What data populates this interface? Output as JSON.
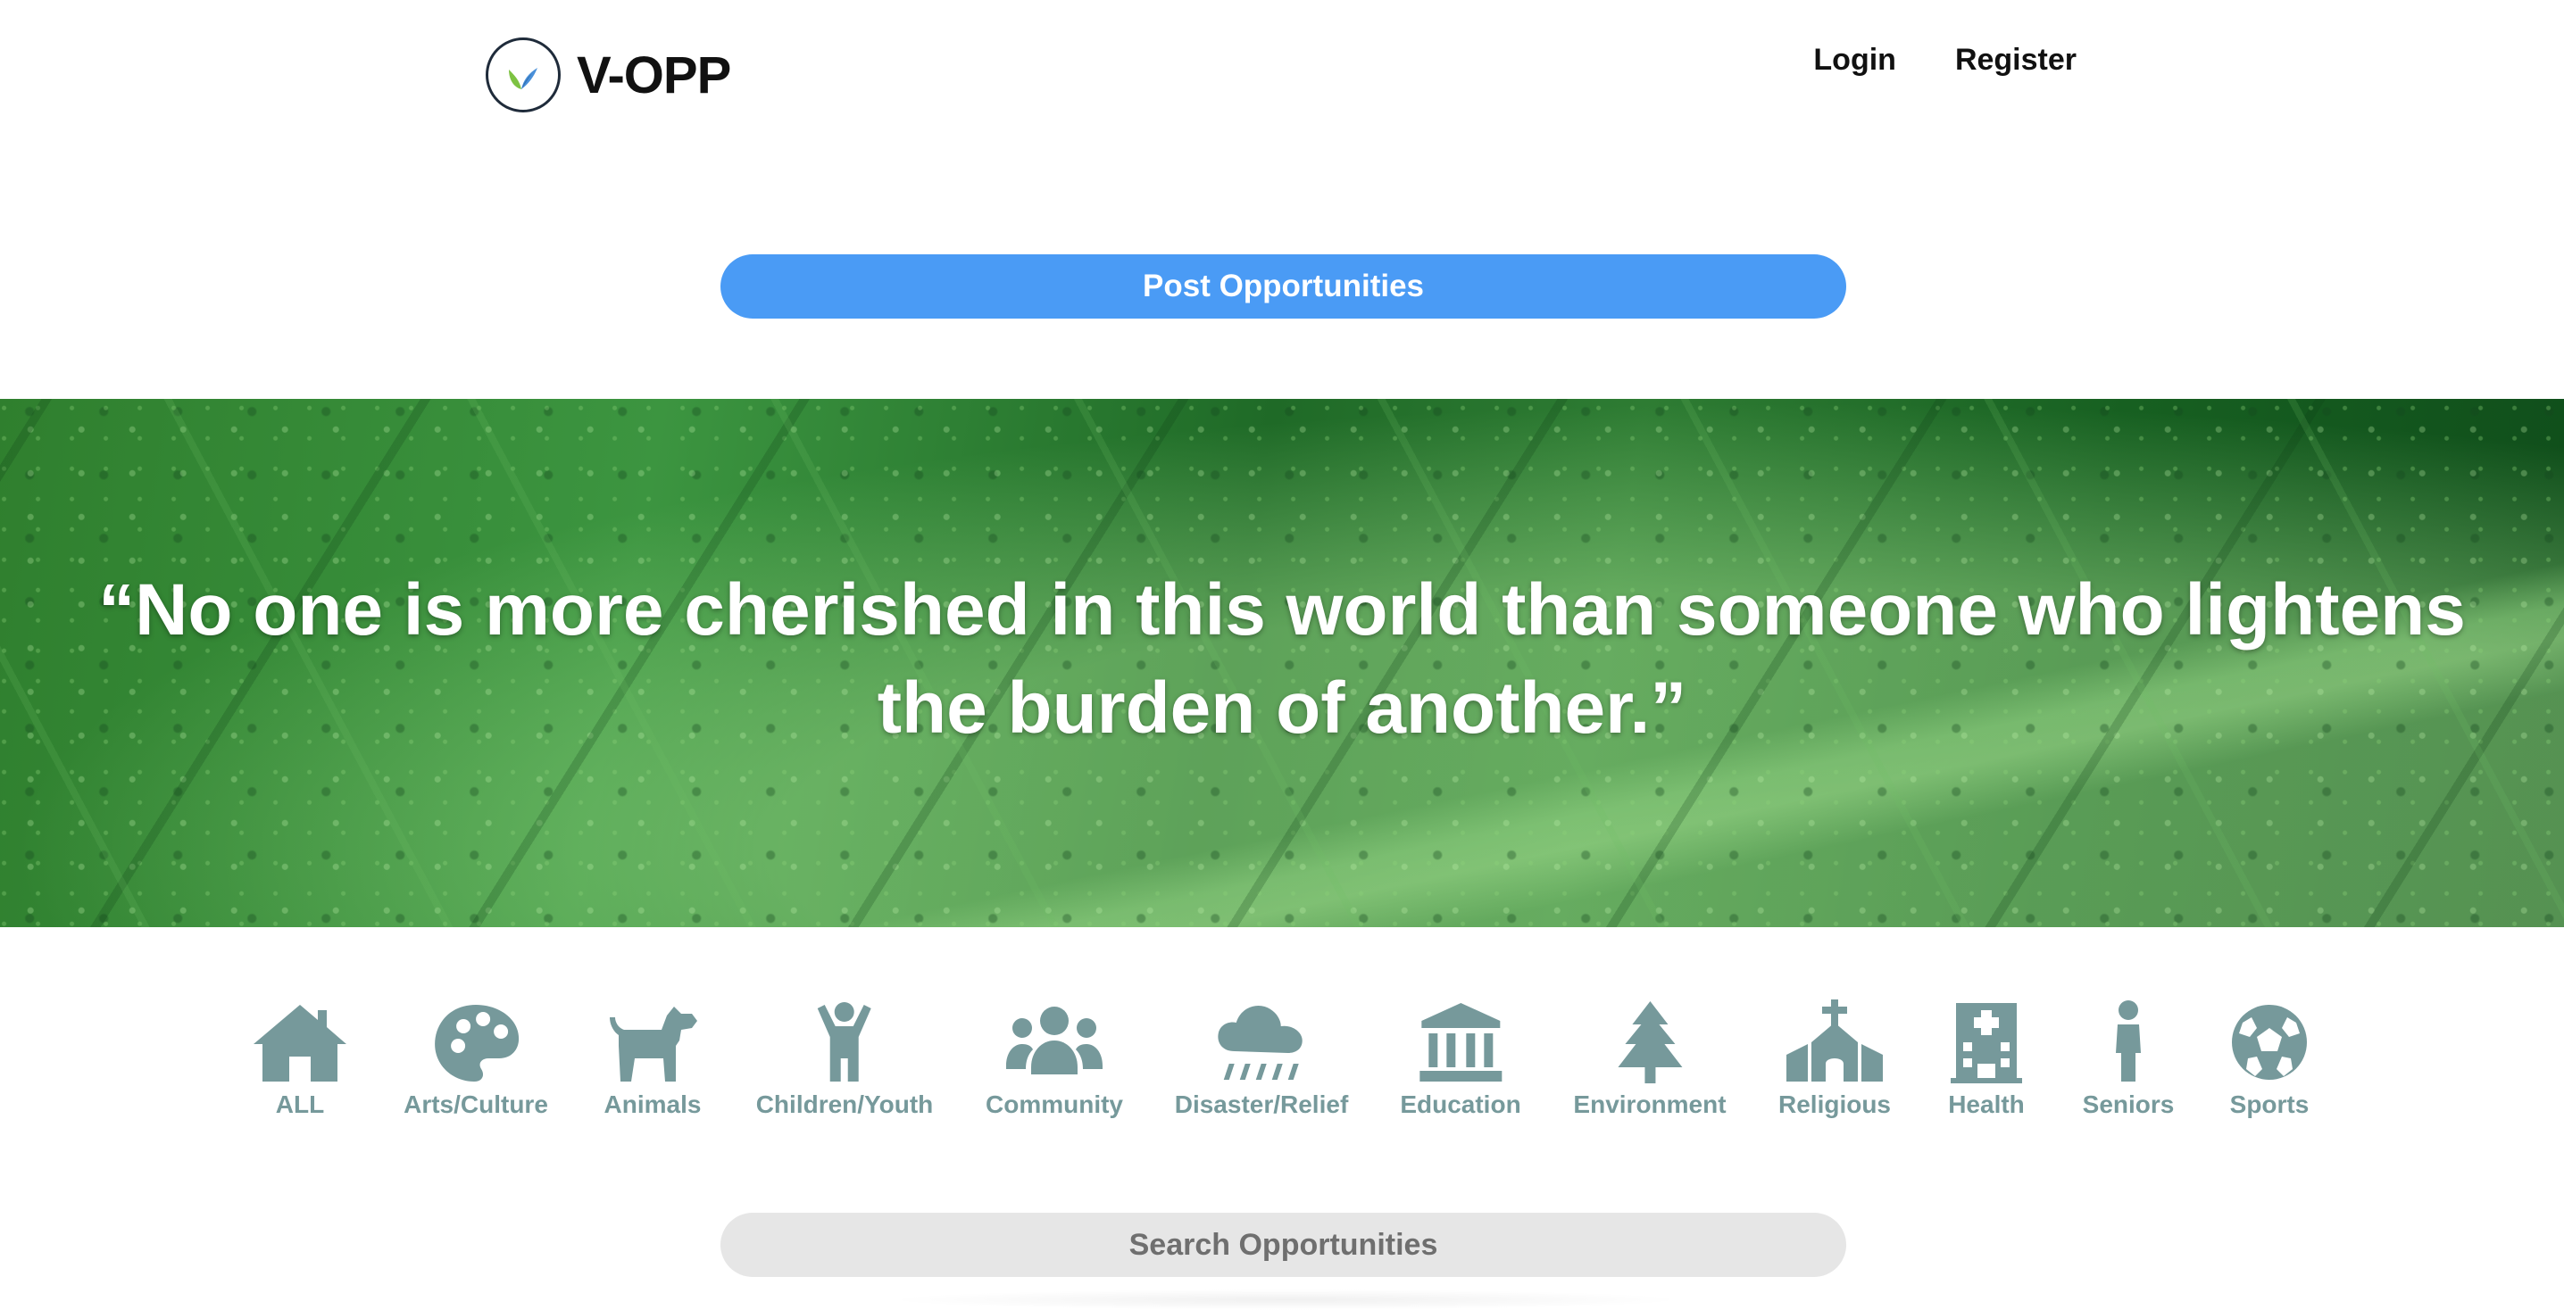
{
  "brand": {
    "name": "V-OPP",
    "logo_icon": "leaves-logo-icon"
  },
  "nav": {
    "login": "Login",
    "register": "Register"
  },
  "post_button": {
    "label": "Post Opportunities",
    "color": "#4a9bf5"
  },
  "hero": {
    "quote": "“No one is more cherished in this world than someone who lightens the burden of another.”"
  },
  "categories": [
    {
      "label": "ALL",
      "icon": "house-icon"
    },
    {
      "label": "Arts/Culture",
      "icon": "palette-icon"
    },
    {
      "label": "Animals",
      "icon": "dog-icon"
    },
    {
      "label": "Children/Youth",
      "icon": "child-icon"
    },
    {
      "label": "Community",
      "icon": "people-group-icon"
    },
    {
      "label": "Disaster/Relief",
      "icon": "cloud-rain-icon"
    },
    {
      "label": "Education",
      "icon": "building-columns-icon"
    },
    {
      "label": "Environment",
      "icon": "tree-icon"
    },
    {
      "label": "Religious",
      "icon": "church-icon"
    },
    {
      "label": "Health",
      "icon": "hospital-icon"
    },
    {
      "label": "Seniors",
      "icon": "person-icon"
    },
    {
      "label": "Sports",
      "icon": "soccer-ball-icon"
    }
  ],
  "category_color": "#76999b",
  "search": {
    "placeholder": "Search Opportunities",
    "value": ""
  }
}
